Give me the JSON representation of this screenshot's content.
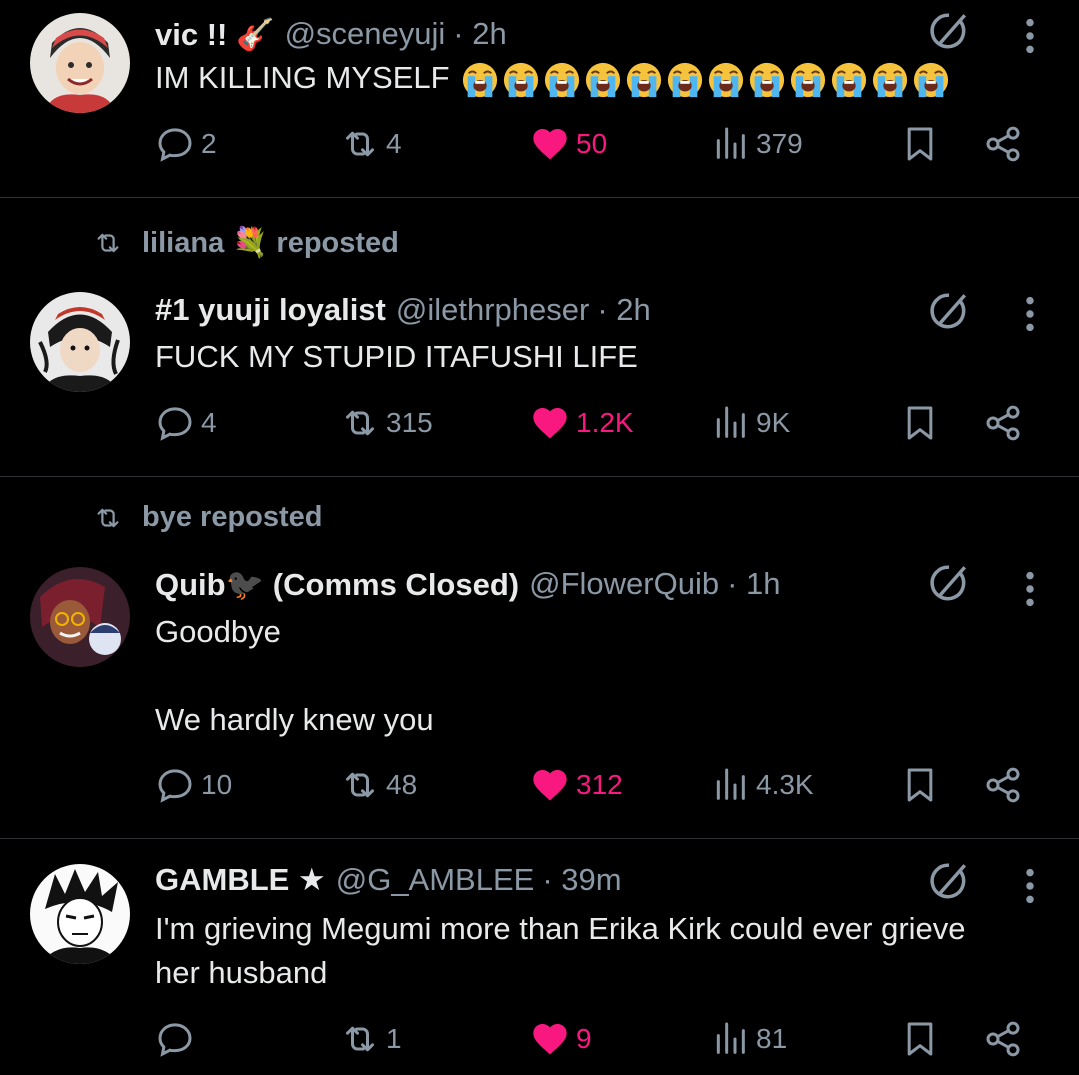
{
  "colors": {
    "background": "#000000",
    "text": "#e7e9ea",
    "muted": "#8b98a5",
    "like": "#f91880",
    "divider": "#2f3336"
  },
  "posts": [
    {
      "reposted_by": "",
      "name": "vic !! 🎸",
      "handle": "@sceneyuji",
      "time": "· 2h",
      "text": "IM KILLING MYSELF",
      "emoji_name": "loudly-crying-face",
      "emoji_count": 12,
      "replies": "2",
      "reposts": "4",
      "likes": "50",
      "views": "379"
    },
    {
      "reposted_by": "liliana 💐 reposted",
      "name": "#1 yuuji loyalist",
      "handle": "@ilethrpheser",
      "time": "· 2h",
      "text": "FUCK MY STUPID ITAFUSHI LIFE",
      "replies": "4",
      "reposts": "315",
      "likes": "1.2K",
      "views": "9K"
    },
    {
      "reposted_by": "bye reposted",
      "name": "Quib🐦‍⬛ (Comms Closed)",
      "handle": "@FlowerQuib",
      "time": "· 1h",
      "text_lines": [
        "Goodbye",
        "",
        "We hardly knew you"
      ],
      "replies": "10",
      "reposts": "48",
      "likes": "312",
      "views": "4.3K"
    },
    {
      "reposted_by": "",
      "name": "GAMBLE ★",
      "handle": "@G_AMBLEE",
      "time": "· 39m",
      "text_lines": [
        "I'm grieving Megumi more than Erika Kirk could ever grieve",
        "her husband"
      ],
      "replies": "",
      "reposts": "1",
      "likes": "9",
      "views": "81"
    }
  ]
}
